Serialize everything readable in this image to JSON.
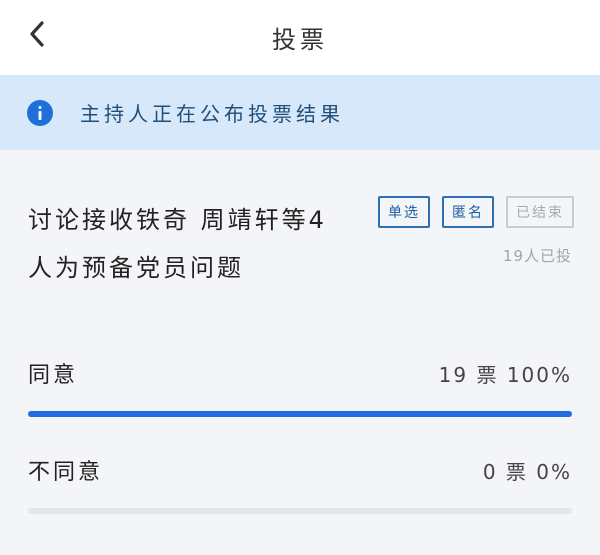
{
  "header": {
    "title": "投票",
    "back_icon": "chevron-left-icon"
  },
  "notice": {
    "icon": "info-icon",
    "text": "主持人正在公布投票结果"
  },
  "poll": {
    "question": "讨论接收铁奇 周靖轩等4人为预备党员问题",
    "tags": [
      "单选",
      "匿名",
      "已结束"
    ],
    "voted_count": "19人已投",
    "options": [
      {
        "label": "同意",
        "votes_text": "19 票",
        "percent_text": "100%",
        "percent": 100
      },
      {
        "label": "不同意",
        "votes_text": "0 票",
        "percent_text": "0%",
        "percent": 0
      }
    ]
  },
  "colors": {
    "accent": "#1f6fe0",
    "notice_bg": "#d7e8fb",
    "tag_border": "#2f6fb0"
  }
}
